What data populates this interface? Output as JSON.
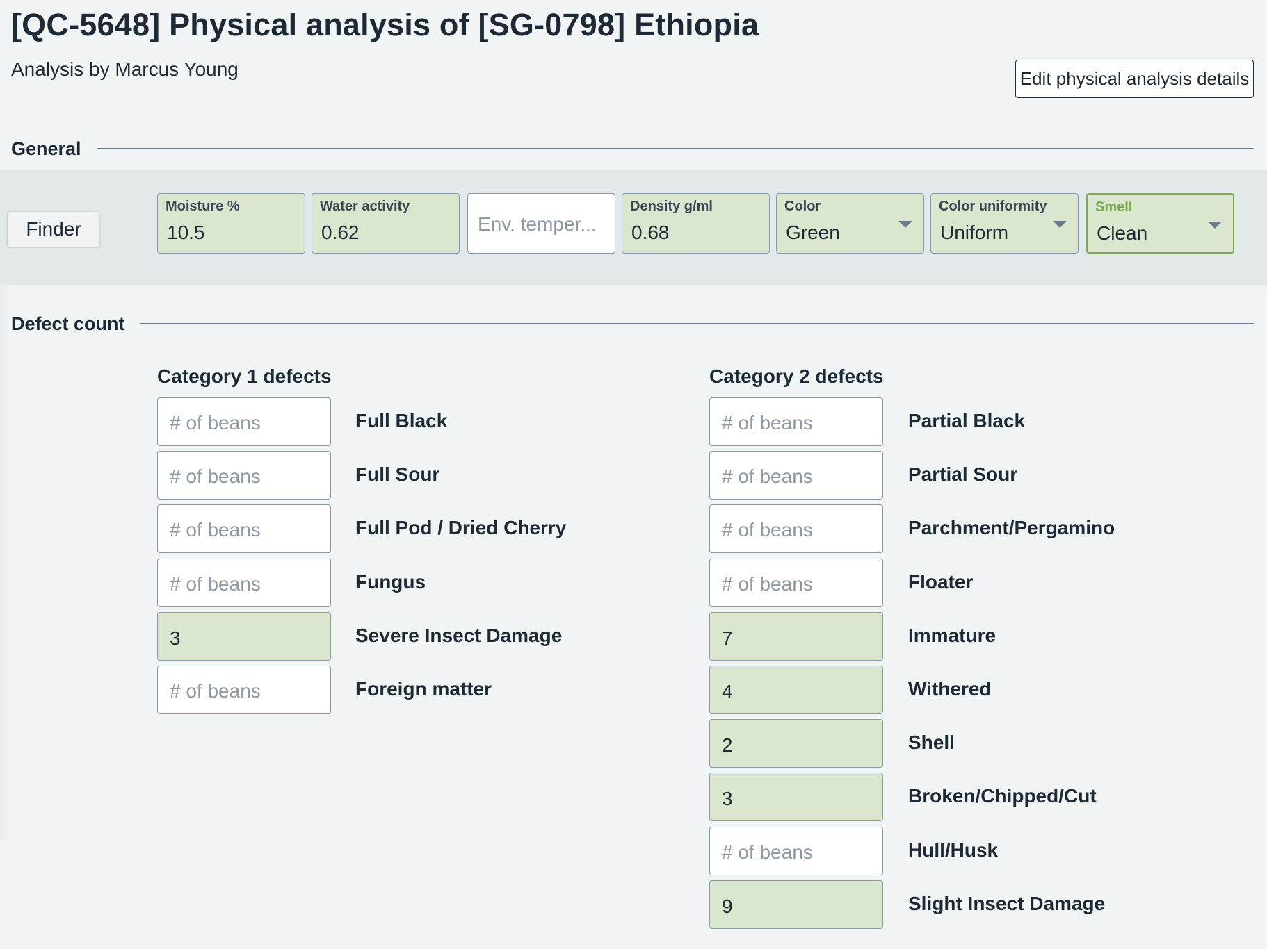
{
  "header": {
    "title": "[QC-5648] Physical analysis of [SG-0798] Ethiopia",
    "subtitle": "Analysis by Marcus Young",
    "edit_button": "Edit physical analysis details"
  },
  "general": {
    "section_label": "General",
    "finder_label": "Finder",
    "moisture": {
      "label": "Moisture %",
      "value": "10.5"
    },
    "water_activity": {
      "label": "Water activity",
      "value": "0.62"
    },
    "env_temperature": {
      "placeholder": "Env. temper..."
    },
    "density": {
      "label": "Density g/ml",
      "value": "0.68"
    },
    "color": {
      "label": "Color",
      "value": "Green"
    },
    "color_uniformity": {
      "label": "Color uniformity",
      "value": "Uniform"
    },
    "smell": {
      "label": "Smell",
      "value": "Clean"
    }
  },
  "defects": {
    "section_label": "Defect count",
    "placeholder": "# of beans",
    "category1": {
      "title": "Category 1 defects",
      "items": [
        {
          "name": "Full Black",
          "value": ""
        },
        {
          "name": "Full Sour",
          "value": ""
        },
        {
          "name": "Full Pod / Dried Cherry",
          "value": ""
        },
        {
          "name": "Fungus",
          "value": ""
        },
        {
          "name": "Severe Insect Damage",
          "value": "3"
        },
        {
          "name": "Foreign matter",
          "value": ""
        }
      ]
    },
    "category2": {
      "title": "Category 2 defects",
      "items": [
        {
          "name": "Partial Black",
          "value": ""
        },
        {
          "name": "Partial Sour",
          "value": ""
        },
        {
          "name": "Parchment/Pergamino",
          "value": ""
        },
        {
          "name": "Floater",
          "value": ""
        },
        {
          "name": "Immature",
          "value": "7"
        },
        {
          "name": "Withered",
          "value": "4"
        },
        {
          "name": "Shell",
          "value": "2"
        },
        {
          "name": "Broken/Chipped/Cut",
          "value": "3"
        },
        {
          "name": "Hull/Husk",
          "value": ""
        },
        {
          "name": "Slight Insect Damage",
          "value": "9"
        }
      ]
    }
  }
}
